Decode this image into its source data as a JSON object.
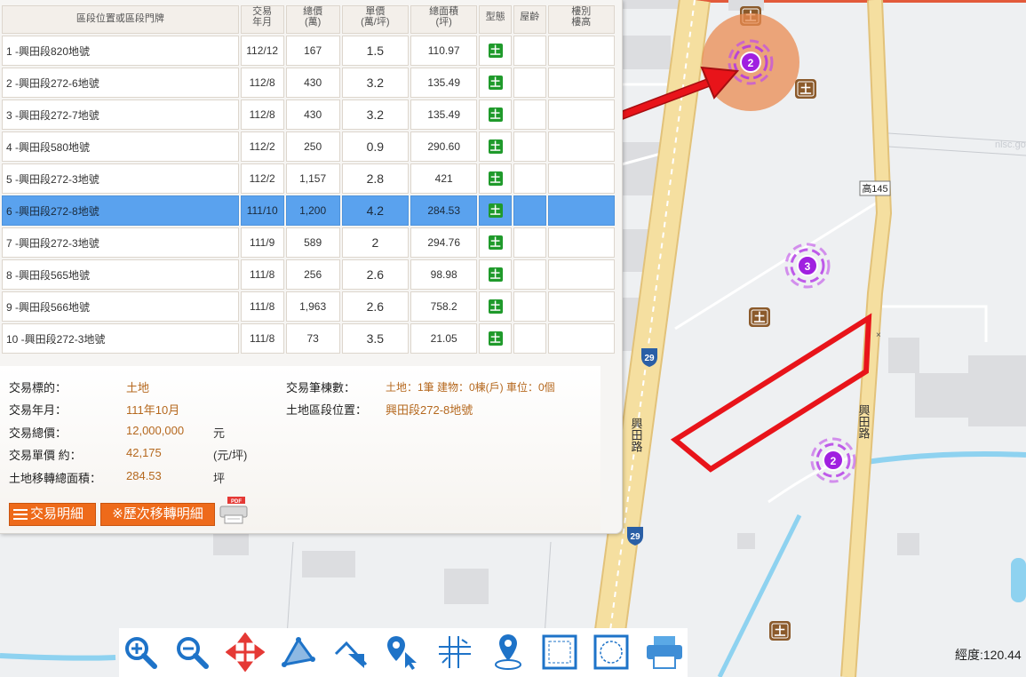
{
  "table": {
    "headers": {
      "location": "區段位置或區段門牌",
      "date_line1": "交易",
      "date_line2": "年月",
      "total_line1": "總價",
      "total_line2": "(萬)",
      "unit_line1": "單價",
      "unit_line2": "(萬/坪)",
      "area_line1": "總面積",
      "area_line2": "(坪)",
      "type": "型態",
      "age": "屋齡",
      "floor_line1": "樓別",
      "floor_line2": "樓高"
    },
    "rows": [
      {
        "loc": "1 -興田段820地號",
        "date": "112/12",
        "total": "167",
        "unit": "1.5",
        "area": "110.97",
        "type": "土",
        "age": "",
        "floor": ""
      },
      {
        "loc": "2 -興田段272-6地號",
        "date": "112/8",
        "total": "430",
        "unit": "3.2",
        "area": "135.49",
        "type": "土",
        "age": "",
        "floor": ""
      },
      {
        "loc": "3 -興田段272-7地號",
        "date": "112/8",
        "total": "430",
        "unit": "3.2",
        "area": "135.49",
        "type": "土",
        "age": "",
        "floor": ""
      },
      {
        "loc": "4 -興田段580地號",
        "date": "112/2",
        "total": "250",
        "unit": "0.9",
        "area": "290.60",
        "type": "土",
        "age": "",
        "floor": ""
      },
      {
        "loc": "5 -興田段272-3地號",
        "date": "112/2",
        "total": "1,157",
        "unit": "2.8",
        "area": "421",
        "type": "土",
        "age": "",
        "floor": ""
      },
      {
        "loc": "6 -興田段272-8地號",
        "date": "111/10",
        "total": "1,200",
        "unit": "4.2",
        "area": "284.53",
        "type": "土",
        "age": "",
        "floor": ""
      },
      {
        "loc": "7 -興田段272-3地號",
        "date": "111/9",
        "total": "589",
        "unit": "2",
        "area": "294.76",
        "type": "土",
        "age": "",
        "floor": ""
      },
      {
        "loc": "8 -興田段565地號",
        "date": "111/8",
        "total": "256",
        "unit": "2.6",
        "area": "98.98",
        "type": "土",
        "age": "",
        "floor": ""
      },
      {
        "loc": "9 -興田段566地號",
        "date": "111/8",
        "total": "1,963",
        "unit": "2.6",
        "area": "758.2",
        "type": "土",
        "age": "",
        "floor": ""
      },
      {
        "loc": "10 -興田段272-3地號",
        "date": "111/8",
        "total": "73",
        "unit": "3.5",
        "area": "21.05",
        "type": "土",
        "age": "",
        "floor": ""
      }
    ]
  },
  "detail": {
    "target_label": "交易標的：",
    "target_value": "土地",
    "month_label": "交易年月：",
    "month_value": "111年10月",
    "total_label": "交易總價：",
    "total_value": "12,000,000",
    "total_unit": "元",
    "unit_label": "交易單價 約：",
    "unit_value": "42,175",
    "unit_unit": "(元/坪)",
    "area_label": "土地移轉總面積：",
    "area_value": "284.53",
    "area_unit": "坪",
    "count_label": "交易筆棟數：",
    "count_value": "土地：1筆 建物：0棟(戶) 車位：0個",
    "section_label": "土地區段位置：",
    "section_value": "興田段272-8地號"
  },
  "buttons": {
    "detail_label": "交易明細",
    "history_label": "※歷次移轉明細",
    "pdf_badge": "PDF"
  },
  "map": {
    "road_name": "興田路",
    "road_name_2": "興田路",
    "route_shield": "29",
    "route_shield_2": "29",
    "county_road": "高145",
    "cluster_a": "2",
    "cluster_b": "3",
    "cluster_c": "2",
    "land_marker": "土",
    "watermark": "nlsc.go"
  },
  "status": {
    "longitude": "經度:120.44"
  },
  "colors": {
    "accent_orange": "#ee6a1a",
    "selected_row": "#5aa2ee",
    "land_green": "#1f9a2b",
    "cluster_purple": "#a020e0",
    "arrow_red": "#e8141a",
    "road_yellow": "#f5dfa0"
  }
}
